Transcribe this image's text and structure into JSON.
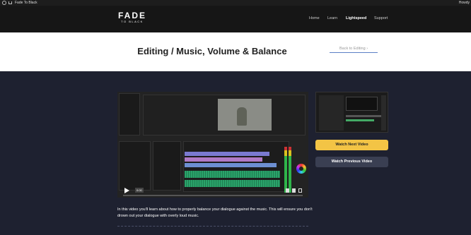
{
  "adminbar": {
    "site_title": "Fade To Black",
    "account": "Howdy"
  },
  "logo": {
    "line1": "FADE",
    "line2": "TO BLACK"
  },
  "nav": {
    "items": [
      {
        "label": "Home"
      },
      {
        "label": "Learn"
      },
      {
        "label": "Lightspeed"
      },
      {
        "label": "Support"
      }
    ],
    "active": "Lightspeed"
  },
  "page": {
    "title": "Editing / Music, Volume & Balance",
    "back_link": "Back to Editing"
  },
  "video": {
    "timecode": "0:00",
    "progress_fraction": 0.0
  },
  "buttons": {
    "next": "Watch Next Video",
    "previous": "Watch Previous Video"
  },
  "description": "In this video you'll learn about how to properly balance your dialogue against the music. This will ensure you don't drown out your dialogue with overly loud music.",
  "colors": {
    "accent_yellow": "#f3c445",
    "background": "#1e2130",
    "header": "#161616",
    "secondary_button": "#3a3f52"
  }
}
